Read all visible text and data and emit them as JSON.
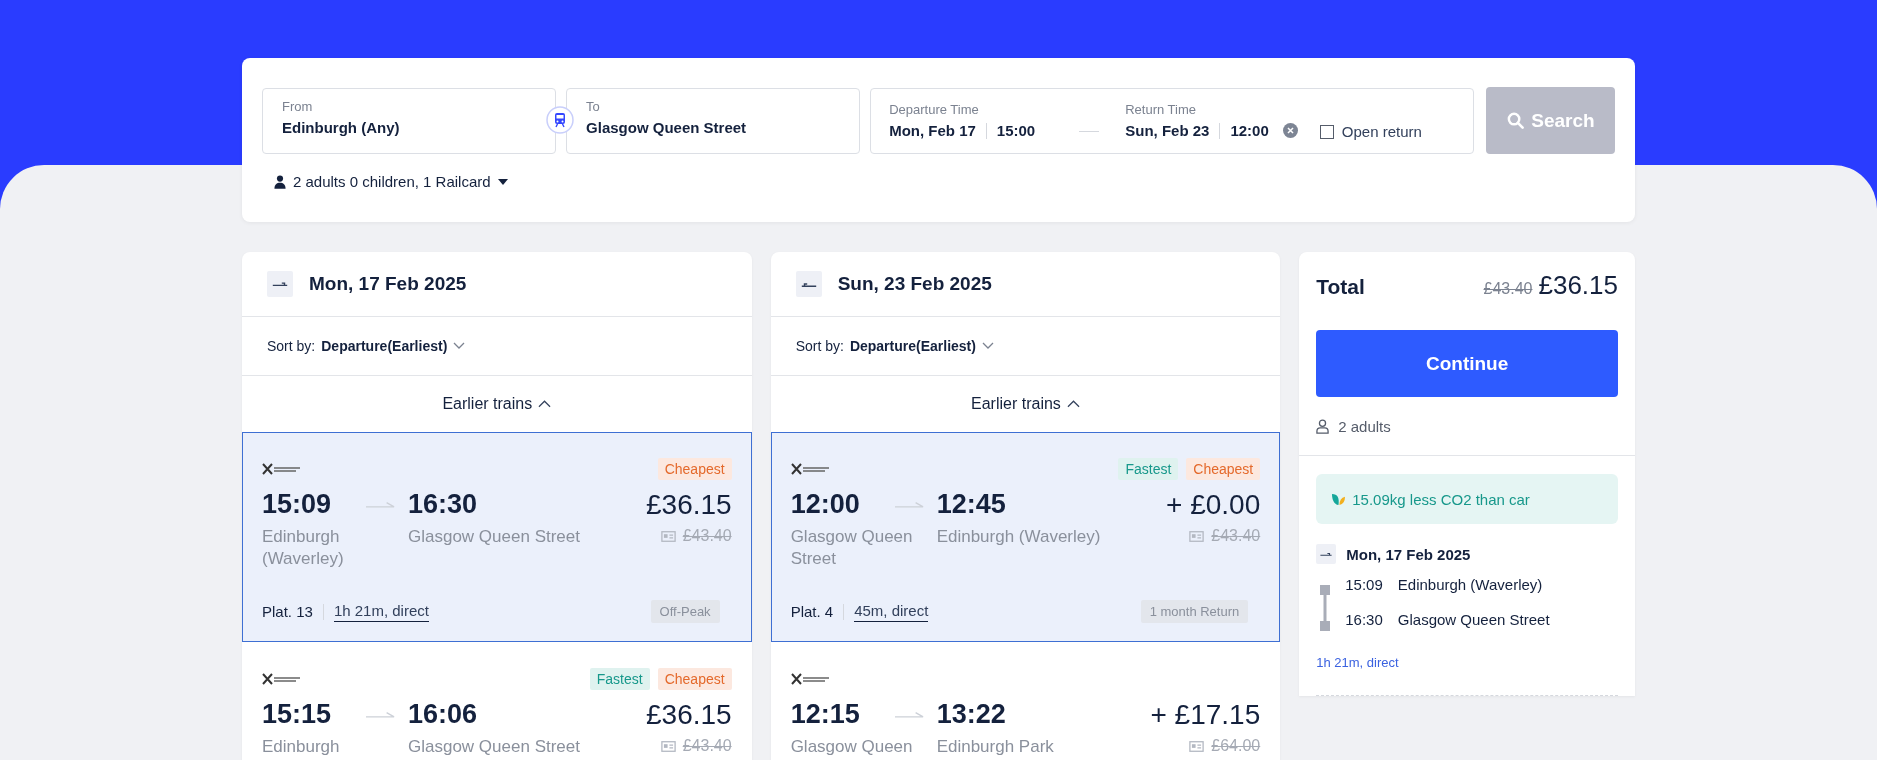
{
  "search": {
    "from": {
      "label": "From",
      "value": "Edinburgh (Any)"
    },
    "to": {
      "label": "To",
      "value": "Glasgow Queen Street"
    },
    "departure": {
      "label": "Departure Time",
      "date": "Mon, Feb 17",
      "time": "15:00"
    },
    "return": {
      "label": "Return Time",
      "date": "Sun, Feb 23",
      "time": "12:00"
    },
    "open_return": {
      "label": "Open return",
      "checked": false
    },
    "search_button": {
      "label": "Search",
      "disabled": true
    },
    "passengers": "2 adults 0 children, 1 Railcard"
  },
  "journeys": [
    {
      "kind": "outbound",
      "date": "Mon, 17 Feb 2025",
      "sort_label": "Sort by:",
      "sort_value": "Departure(Earliest)",
      "earlier": "Earlier trains",
      "trains": [
        {
          "selected": true,
          "tags": [
            {
              "label": "Cheapest",
              "kind": "cheapest"
            }
          ],
          "depart": "15:09",
          "arrive": "16:30",
          "from": "Edinburgh (Waverley)",
          "to": "Glasgow Queen Street",
          "price": "£36.15",
          "old_price": "£43.40",
          "platform": "Plat. 13",
          "duration": "1h 21m, direct",
          "fare_type": "Off-Peak"
        },
        {
          "selected": false,
          "tags": [
            {
              "label": "Fastest",
              "kind": "fastest"
            },
            {
              "label": "Cheapest",
              "kind": "cheapest"
            }
          ],
          "depart": "15:15",
          "arrive": "16:06",
          "from": "Edinburgh",
          "to": "Glasgow Queen Street",
          "price": "£36.15",
          "old_price": "£43.40"
        }
      ]
    },
    {
      "kind": "return",
      "date": "Sun, 23 Feb 2025",
      "sort_label": "Sort by:",
      "sort_value": "Departure(Earliest)",
      "earlier": "Earlier trains",
      "trains": [
        {
          "selected": true,
          "tags": [
            {
              "label": "Fastest",
              "kind": "fastest"
            },
            {
              "label": "Cheapest",
              "kind": "cheapest"
            }
          ],
          "depart": "12:00",
          "arrive": "12:45",
          "from": "Glasgow Queen Street",
          "to": "Edinburgh (Waverley)",
          "price": "+ £0.00",
          "old_price": "£43.40",
          "platform": "Plat. 4",
          "duration": "45m, direct",
          "fare_type": "1 month Return"
        },
        {
          "selected": false,
          "depart": "12:15",
          "arrive": "13:22",
          "from": "Glasgow Queen",
          "to": "Edinburgh Park",
          "price": "+ £17.15",
          "old_price": "£64.00"
        }
      ]
    }
  ],
  "summary": {
    "total_label": "Total",
    "old_total": "£43.40",
    "total": "£36.15",
    "continue": "Continue",
    "passengers": "2 adults",
    "co2": "15.09kg less CO2 than car",
    "date": "Mon, 17 Feb 2025",
    "stops": [
      {
        "time": "15:09",
        "station": "Edinburgh (Waverley)"
      },
      {
        "time": "16:30",
        "station": "Glasgow Queen Street"
      }
    ],
    "duration": "1h 21m, direct"
  }
}
